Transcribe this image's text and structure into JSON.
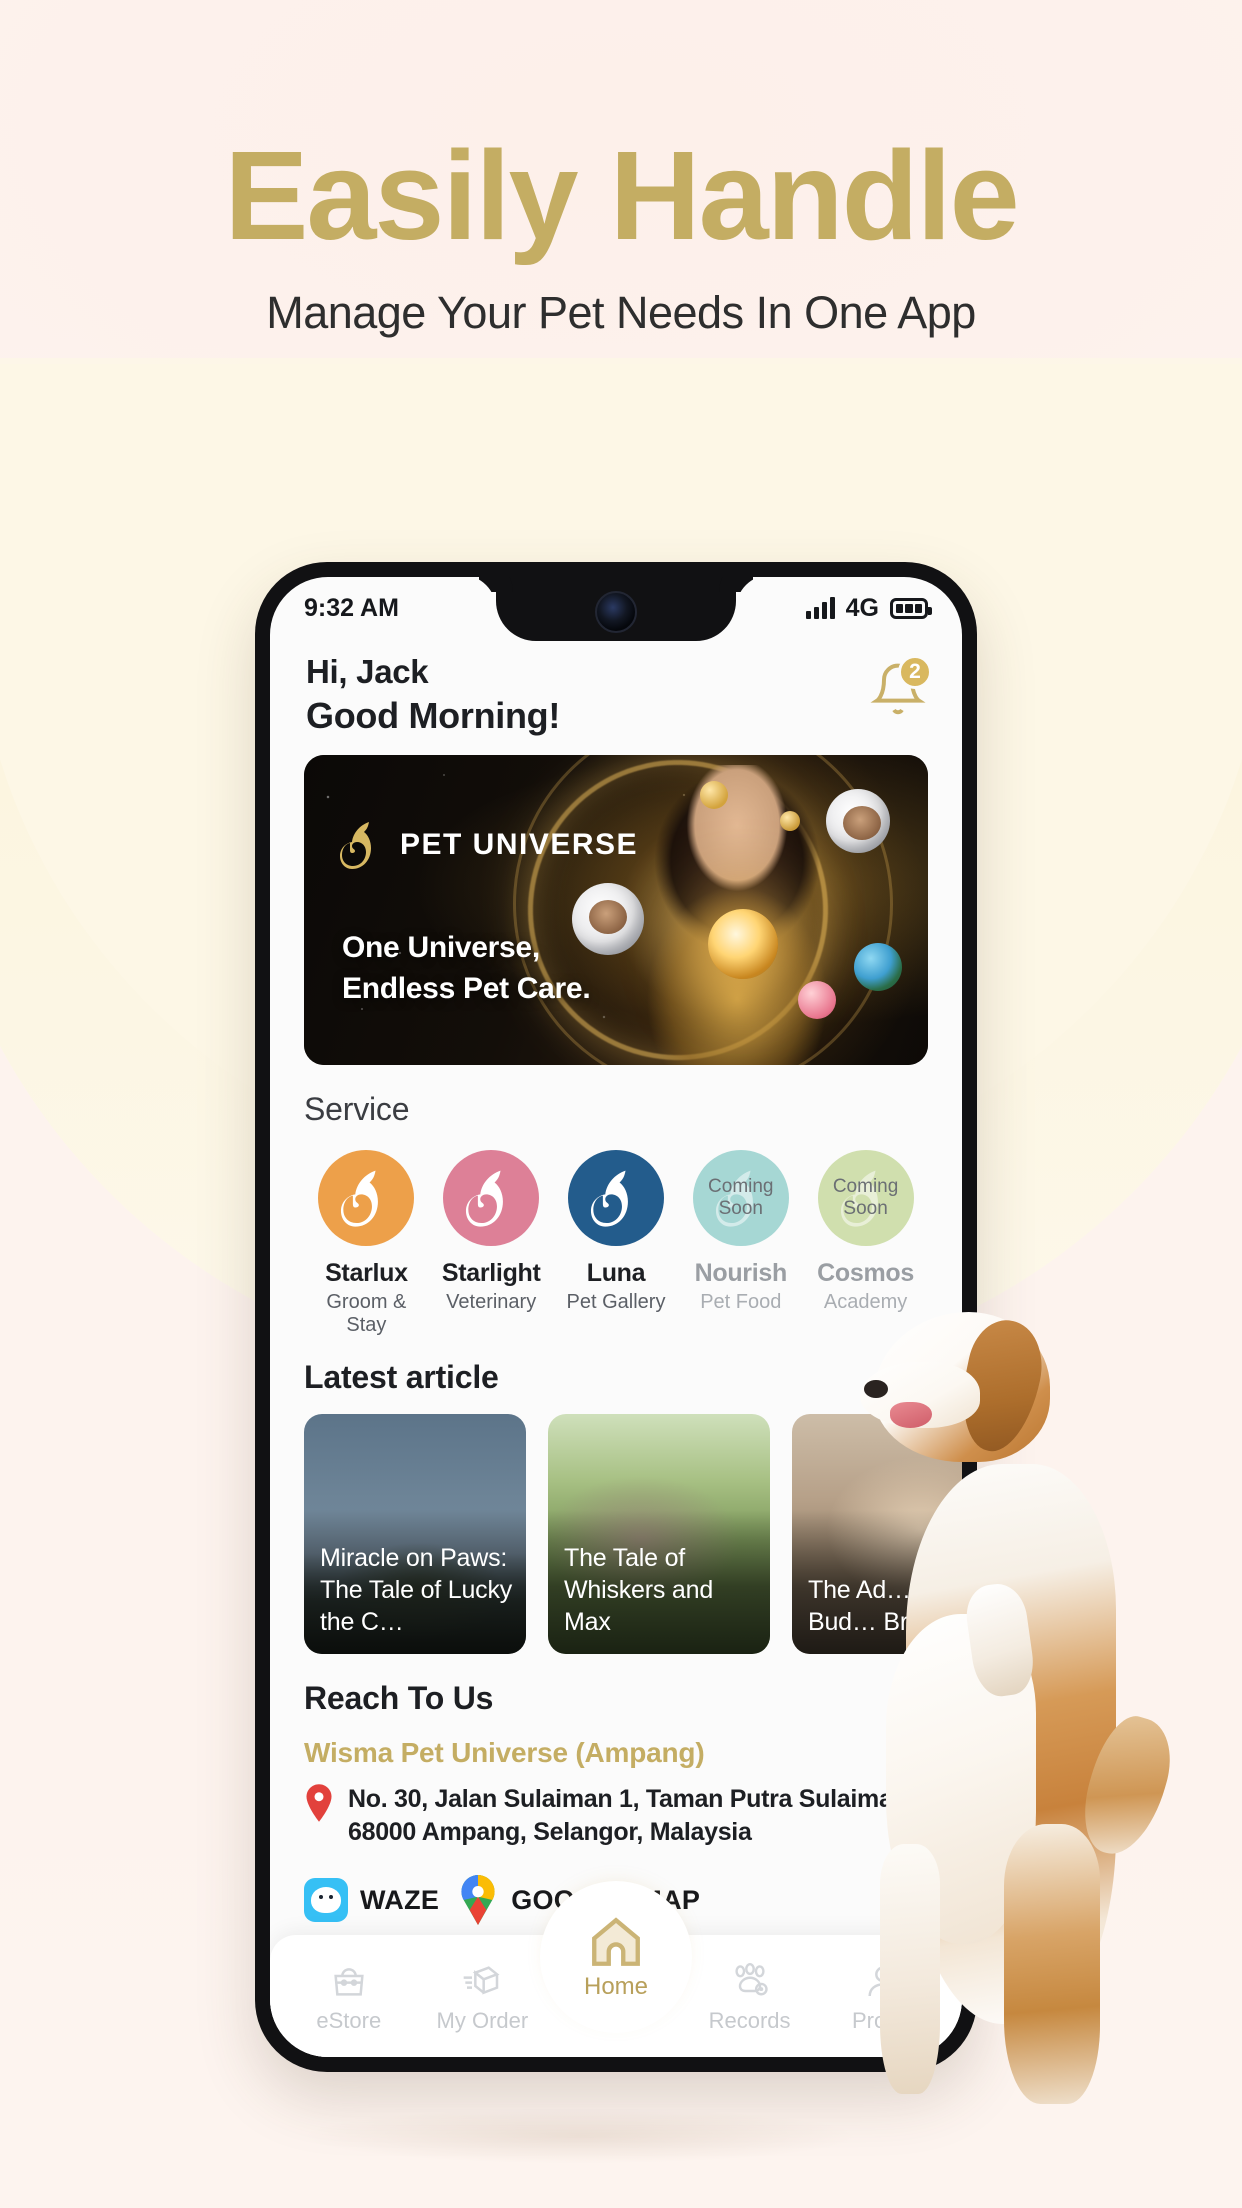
{
  "promo": {
    "headline": "Easily Handle",
    "subheadline": "Manage Your Pet Needs In One App",
    "headline_color": "#c4ad63"
  },
  "phone": {
    "statusbar": {
      "time": "9:32 AM",
      "network": "4G",
      "signal_icon": "signal-bars-icon",
      "battery_icon": "battery-icon"
    },
    "header": {
      "greeting_name": "Hi, Jack",
      "greeting_message": "Good Morning!",
      "bell_icon": "bell-icon",
      "notification_count": "2"
    },
    "banner": {
      "brand": "PET UNIVERSE",
      "logo_icon": "cat-dog-logo-icon",
      "tagline_line1": "One Universe,",
      "tagline_line2": "Endless Pet Care."
    },
    "service": {
      "title": "Service",
      "items": [
        {
          "name": "Starlux",
          "sub": "Groom & Stay",
          "color": "#eda04a",
          "coming_soon": "",
          "disabled": false
        },
        {
          "name": "Starlight",
          "sub": "Veterinary",
          "color": "#dd8097",
          "coming_soon": "",
          "disabled": false
        },
        {
          "name": "Luna",
          "sub": "Pet Gallery",
          "color": "#235c8c",
          "coming_soon": "",
          "disabled": false
        },
        {
          "name": "Nourish",
          "sub": "Pet Food",
          "color": "#a6d7d4",
          "coming_soon": "Coming\nSoon",
          "disabled": true
        },
        {
          "name": "Cosmos",
          "sub": "Academy",
          "color": "#d0dfae",
          "coming_soon": "Coming\nSoon",
          "disabled": true
        }
      ],
      "coming_soon_line1": "Coming",
      "coming_soon_line2": "Soon"
    },
    "article": {
      "title": "Latest article",
      "cards": [
        {
          "title": "Miracle on Paws: The Tale of Lucky the C…",
          "image": "cat-in-night-field"
        },
        {
          "title": "The Tale of Whiskers and Max",
          "image": "cat-in-grass"
        },
        {
          "title": "The Ad… of Bud… Brav…",
          "image": "dogs-outdoors"
        }
      ]
    },
    "reach": {
      "title": "Reach To Us",
      "branch_name": "Wisma Pet Universe (Ampang)",
      "pin_icon": "location-pin-icon",
      "pin_color": "#e2413c",
      "address_line1": "No. 30, Jalan Sulaiman 1, Taman Putra Sulaiman,",
      "address_line2": "68000 Ampang, Selangor, Malaysia",
      "waze_label": "WAZE",
      "waze_icon": "waze-icon",
      "gmap_label": "GOOGLE MAP",
      "gmap_icon": "google-maps-pin-icon"
    },
    "bottomnav": {
      "items": [
        {
          "label": "eStore",
          "icon": "pet-carrier-icon",
          "active": false
        },
        {
          "label": "My Order",
          "icon": "package-box-icon",
          "active": false
        },
        {
          "label": "Home",
          "icon": "home-icon",
          "active": true
        },
        {
          "label": "Records",
          "icon": "paw-record-icon",
          "active": false
        },
        {
          "label": "Profile",
          "icon": "person-icon",
          "active": false
        }
      ],
      "active_color": "#b8a05b"
    }
  }
}
